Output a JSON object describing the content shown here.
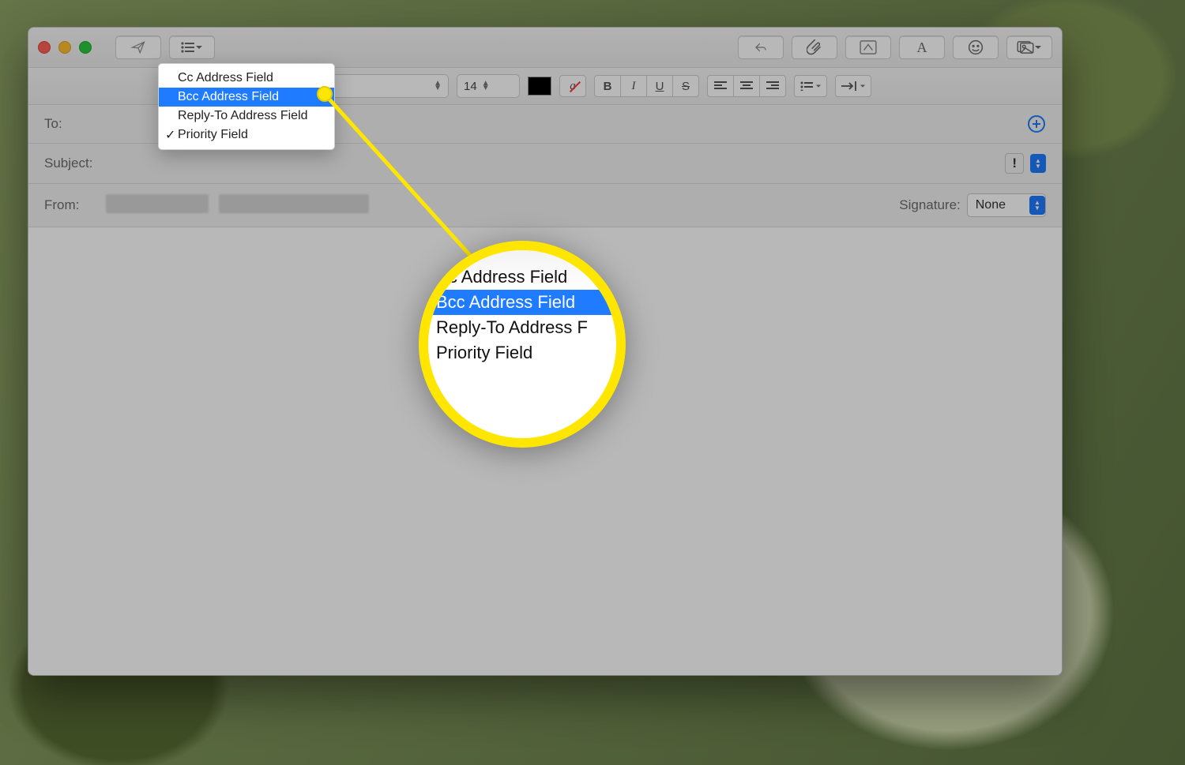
{
  "toolbar": {
    "font_size": "14"
  },
  "dropdown": {
    "items": [
      {
        "label": "Cc Address Field",
        "selected": false,
        "checked": false
      },
      {
        "label": "Bcc Address Field",
        "selected": true,
        "checked": false
      },
      {
        "label": "Reply-To Address Field",
        "selected": false,
        "checked": false
      },
      {
        "label": "Priority Field",
        "selected": false,
        "checked": true
      }
    ]
  },
  "fields": {
    "to_label": "To:",
    "subject_label": "Subject:",
    "from_label": "From:",
    "signature_label": "Signature:",
    "signature_value": "None",
    "priority_symbol": "!"
  },
  "magnifier": {
    "items": [
      {
        "label": "Cc Address Field",
        "selected": false
      },
      {
        "label": "Bcc Address Field",
        "selected": true
      },
      {
        "label": "Reply-To Address F",
        "selected": false
      },
      {
        "label": "Priority Field",
        "selected": false
      }
    ]
  }
}
